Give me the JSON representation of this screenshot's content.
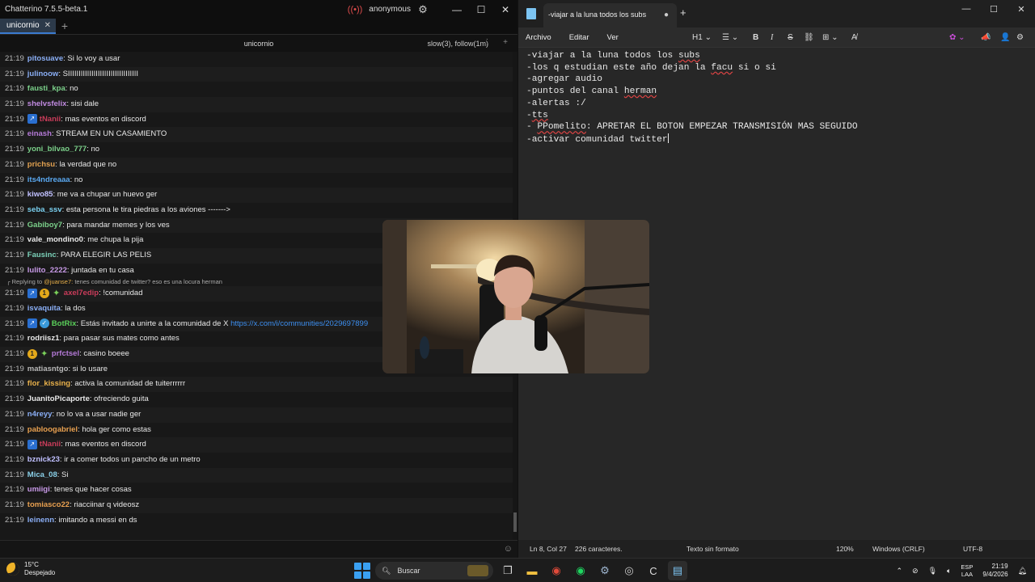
{
  "chatterino": {
    "title": "Chatterino 7.5.5-beta.1",
    "account": "anonymous",
    "tab_label": "unicornio",
    "tab_close": "✕",
    "tab_add": "+",
    "channel_name": "unicornio",
    "chat_modes": "slow(3), follow(1m)",
    "messages": [
      {
        "time": "21:19",
        "user": "pitosuave",
        "color": "#8aaef5",
        "text": "Si lo voy a usar"
      },
      {
        "time": "21:19",
        "user": "julinoow",
        "color": "#8aaef5",
        "text": "SIIIIIIIIIIIIIIIIIIIIIIIIIIIIIIIII"
      },
      {
        "time": "21:19",
        "user": "fausti_kpa",
        "color": "#7bd08a",
        "text": "no"
      },
      {
        "time": "21:19",
        "user": "shelvsfelix",
        "color": "#c08ae0",
        "text": "sisi dale"
      },
      {
        "time": "21:19",
        "user": "tNanii",
        "color": "#c93c5a",
        "text": "mas eventos en discord",
        "badges": [
          "bot"
        ]
      },
      {
        "time": "21:19",
        "user": "einash",
        "color": "#b57ad8",
        "text": "STREAM EN UN CASAMIENTO"
      },
      {
        "time": "21:19",
        "user": "yoni_bilvao_777",
        "color": "#7bd08a",
        "text": "no"
      },
      {
        "time": "21:19",
        "user": "prichsu",
        "color": "#e0a050",
        "text": "la verdad que no"
      },
      {
        "time": "21:19",
        "user": "its4ndreaaa",
        "color": "#5aa8f0",
        "text": "no"
      },
      {
        "time": "21:19",
        "user": "kiwo85",
        "color": "#c0c0ff",
        "text": "me va a chupar un huevo ger"
      },
      {
        "time": "21:19",
        "user": "seba_ssv",
        "color": "#7ad0f0",
        "text": "esta persona le tira piedras a los aviones ------->"
      },
      {
        "time": "21:19",
        "user": "Gabiboy7",
        "color": "#7bd08a",
        "text": "para mandar memes y los ves"
      },
      {
        "time": "21:19",
        "user": "vale_mondino0",
        "color": "#e8e8e8",
        "text": "me chupa la pija"
      },
      {
        "time": "21:19",
        "user": "Fausinc",
        "color": "#7bd0b8",
        "text": "PARA ELEGIR LAS PELIS"
      },
      {
        "time": "21:19",
        "user": "lulito_2222",
        "color": "#c89ae8",
        "text": "juntada en tu casa"
      },
      {
        "time": "21:19",
        "user": "axel7edip",
        "color": "#c93c5a",
        "text": "!comunidad",
        "badges": [
          "bot",
          "sub",
          "star"
        ],
        "reply": true
      },
      {
        "time": "21:19",
        "user": "isvaquita",
        "color": "#8aaef5",
        "text": "la dos"
      },
      {
        "time": "21:19",
        "user": "BotRix",
        "color": "#5ad05a",
        "text": "Estás invitado a unirte a la comunidad de X",
        "link": "https://x.com/i/communities/2029697899",
        "badges": [
          "bot",
          "verified"
        ]
      },
      {
        "time": "21:19",
        "user": "rodriisz1",
        "color": "#e8e8e8",
        "text": "para pasar sus mates como antes"
      },
      {
        "time": "21:19",
        "user": "prfctsel",
        "color": "#b57ad8",
        "text": "casino boeee",
        "badges": [
          "sub",
          "star"
        ]
      },
      {
        "time": "21:19",
        "user": "matiasntgo",
        "color": "#b8b8b8",
        "text": "si lo usare"
      },
      {
        "time": "21:19",
        "user": "flor_kissing",
        "color": "#e8b04a",
        "text": "activa la comunidad de tuiterrrrrr"
      },
      {
        "time": "21:19",
        "user": "JuanitoPicaporte",
        "color": "#e8e8e8",
        "text": "ofreciendo guita"
      },
      {
        "time": "21:19",
        "user": "n4reyy",
        "color": "#8aaef5",
        "text": "no lo va a usar nadie ger"
      },
      {
        "time": "21:19",
        "user": "pabloogabriel",
        "color": "#e8a050",
        "text": "hola ger como estas"
      },
      {
        "time": "21:19",
        "user": "tNanii",
        "color": "#c93c5a",
        "text": "mas eventos en discord",
        "badges": [
          "bot"
        ]
      },
      {
        "time": "21:19",
        "user": "bznick23",
        "color": "#c0c0ff",
        "text": "ir a comer todos un pancho de un metro"
      },
      {
        "time": "21:19",
        "user": "Mica_08",
        "color": "#8ad0e8",
        "text": "Si"
      },
      {
        "time": "21:19",
        "user": "umiigi",
        "color": "#c89ae8",
        "text": "tenes que hacer cosas"
      },
      {
        "time": "21:19",
        "user": "tomiasco22",
        "color": "#e8a050",
        "text": "riacciinar q videosz"
      },
      {
        "time": "21:19",
        "user": "leinenn",
        "color": "#8aaef5",
        "text": "imitando a messi en ds"
      }
    ],
    "reply_label": "Replying to",
    "reply_to_user": "@juanse7:",
    "reply_text": "tenes comunidad de twitter? eso es una locura herman"
  },
  "notepad": {
    "tab_title": "-viajar a la luna todos los subs",
    "menus": [
      "Archivo",
      "Editar",
      "Ver"
    ],
    "heading_select": "H1",
    "lines": [
      "-viajar a la luna todos los subs",
      "-los q estudian este año dejan la facu si o si",
      "-agregar audio",
      "-puntos del canal herman",
      "-alertas :/",
      "-tts",
      "- PPomelito: APRETAR EL BOTON EMPEZAR TRANSMISIÓN MAS SEGUIDO",
      "-activar comunidad twitter"
    ],
    "status": {
      "position": "Ln 8, Col 27",
      "chars": "226 caracteres.",
      "format": "Texto sin formato",
      "zoom": "120%",
      "line_ending": "Windows (CRLF)",
      "encoding": "UTF-8"
    }
  },
  "taskbar": {
    "temp": "15°C",
    "weather": "Despejado",
    "search_placeholder": "Buscar",
    "lang_1": "ESP",
    "lang_2": "LAA",
    "time": "21:19",
    "date": "9/4/2026"
  },
  "colors": {
    "link": "#3d8ff0",
    "accent": "#3b7bd0",
    "spell_error": "#e04444"
  }
}
